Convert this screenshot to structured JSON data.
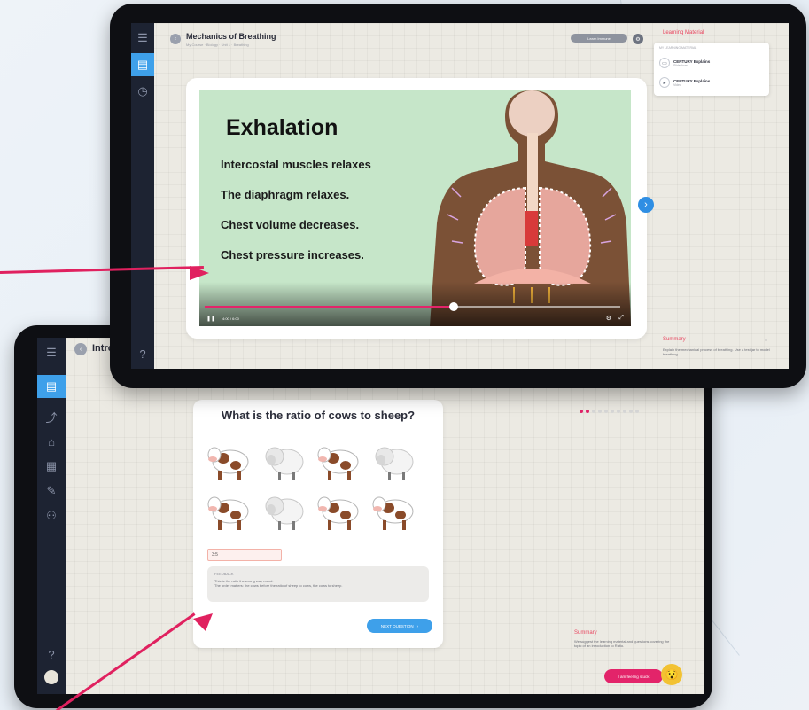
{
  "front": {
    "title": "Mechanics of Breathing",
    "subtitle": "My Course · Biology · Unit 1 · Breathing",
    "badge": "Learn Immune",
    "learning_material": {
      "header": "Learning Material",
      "section": "MY LEARNING MATERIAL",
      "items": [
        {
          "title": "CENTURY Explains",
          "sub": "Slideshow",
          "icon": "slides-icon"
        },
        {
          "title": "CENTURY Explains",
          "sub": "Video",
          "icon": "play-icon"
        }
      ]
    },
    "slide": {
      "title": "Exhalation",
      "lines": [
        "Intercostal muscles relaxes",
        "The diaphragm relaxes.",
        "Chest volume decreases.",
        "Chest pressure increases."
      ]
    },
    "video": {
      "time": "4:00 / 6:00",
      "progress": 0.6
    },
    "summary": {
      "title": "Summary",
      "text": "Explain the mechanical process of breathing. Use a test jar to model breathing."
    }
  },
  "back": {
    "title": "Intro",
    "quiz": {
      "question": "What is the ratio of cows to sheep?",
      "answer": "3:5",
      "feedback_label": "FEEDBACK",
      "feedback_lines": [
        "This is the ratio the wrong way round.",
        "The order matters: the cows before the ratio of sheep to cows, the cows to sheep."
      ],
      "next_label": "NEXT QUESTION",
      "animals": [
        "cow",
        "sheep",
        "cow",
        "sheep",
        "cow",
        "sheep",
        "cow",
        "cow"
      ]
    },
    "progress_dots": {
      "filled": 2,
      "total": 10
    },
    "summary": {
      "title": "Summary",
      "text": "We suggest the learning material and questions covering the topic of an introduction to Ratio."
    },
    "help_button": "I am feeling stuck"
  },
  "colors": {
    "accent": "#e3246a",
    "blue": "#3ea0ea",
    "sidebar": "#1d2332",
    "slide_bg": "#c6e6c9"
  }
}
